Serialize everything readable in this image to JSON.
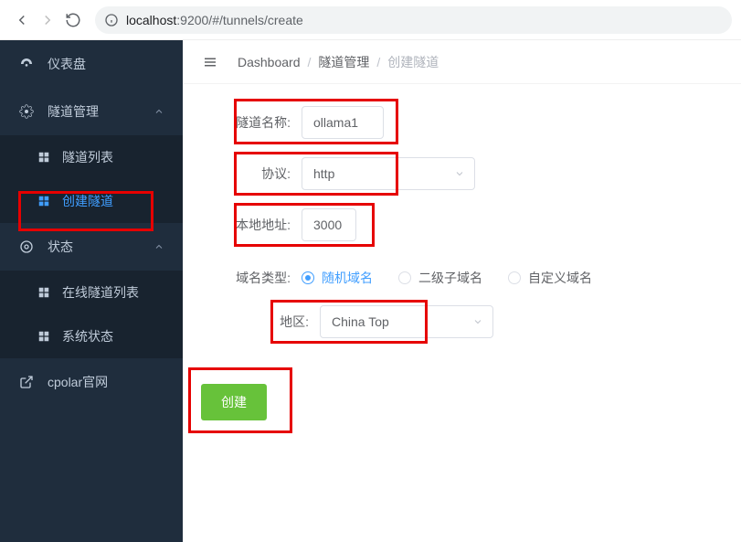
{
  "browser": {
    "url_host": "localhost",
    "url_port_path": ":9200/#/tunnels/create"
  },
  "sidebar": {
    "items": [
      {
        "label": "仪表盘",
        "type": "single"
      },
      {
        "label": "隧道管理",
        "type": "group",
        "expanded": true,
        "children": [
          {
            "label": "隧道列表"
          },
          {
            "label": "创建隧道",
            "active": true
          }
        ]
      },
      {
        "label": "状态",
        "type": "group",
        "expanded": true,
        "children": [
          {
            "label": "在线隧道列表"
          },
          {
            "label": "系统状态"
          }
        ]
      },
      {
        "label": "cpolar官网",
        "type": "single"
      }
    ]
  },
  "breadcrumb": {
    "root": "Dashboard",
    "path1": "隧道管理",
    "current": "创建隧道"
  },
  "form": {
    "tunnel_name_label": "隧道名称:",
    "tunnel_name_value": "ollama1",
    "protocol_label": "协议:",
    "protocol_value": "http",
    "local_addr_label": "本地地址:",
    "local_addr_value": "3000",
    "domain_type_label": "域名类型:",
    "domain_options": [
      {
        "label": "随机域名",
        "selected": true
      },
      {
        "label": "二级子域名",
        "selected": false
      },
      {
        "label": "自定义域名",
        "selected": false
      }
    ],
    "region_label": "地区:",
    "region_value": "China Top",
    "submit_label": "创建"
  }
}
